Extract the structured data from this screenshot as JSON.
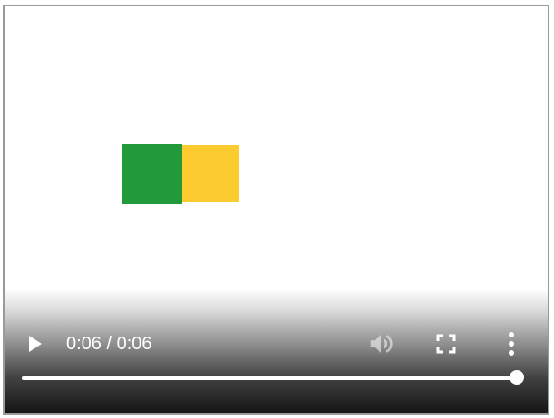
{
  "video": {
    "frame": {
      "shapes": [
        {
          "name": "green-square",
          "color": "#239a3a"
        },
        {
          "name": "yellow-square",
          "color": "#fccb2f"
        }
      ]
    }
  },
  "controls": {
    "play_icon": "play-icon",
    "time_display": "0:06 / 0:06",
    "mute_icon": "volume-icon",
    "fullscreen_icon": "fullscreen-icon",
    "more_icon": "more-vertical-icon",
    "progress_fraction": 1.0
  }
}
